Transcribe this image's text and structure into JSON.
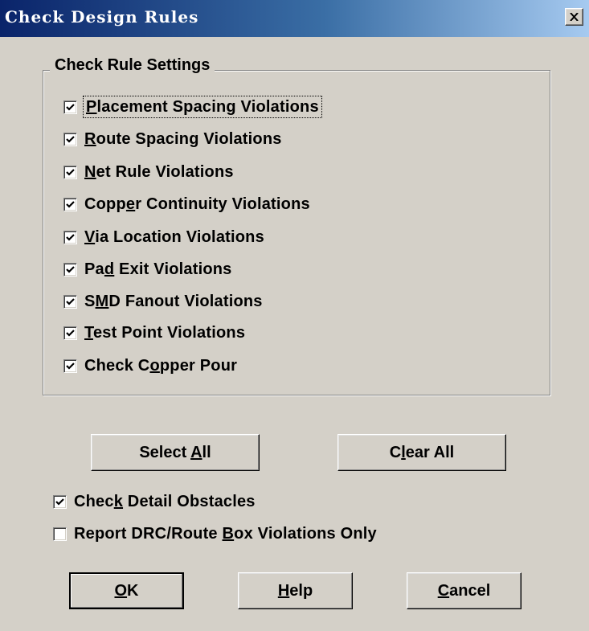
{
  "window": {
    "title": "Check Design Rules"
  },
  "group": {
    "label": "Check Rule Settings",
    "items": [
      {
        "pre": "",
        "ul": "P",
        "post": "lacement Spacing Violations",
        "checked": true
      },
      {
        "pre": "",
        "ul": "R",
        "post": "oute Spacing Violations",
        "checked": true
      },
      {
        "pre": "",
        "ul": "N",
        "post": "et Rule Violations",
        "checked": true
      },
      {
        "pre": "Copp",
        "ul": "e",
        "post": "r Continuity Violations",
        "checked": true
      },
      {
        "pre": "",
        "ul": "V",
        "post": "ia Location Violations",
        "checked": true
      },
      {
        "pre": "Pa",
        "ul": "d",
        "post": " Exit Violations",
        "checked": true
      },
      {
        "pre": "S",
        "ul": "M",
        "post": "D Fanout Violations",
        "checked": true
      },
      {
        "pre": "",
        "ul": "T",
        "post": "est Point Violations",
        "checked": true
      },
      {
        "pre": "Check C",
        "ul": "o",
        "post": "pper Pour",
        "checked": true
      }
    ]
  },
  "select_all": {
    "pre": "Select ",
    "ul": "A",
    "post": "ll"
  },
  "clear_all": {
    "pre": "C",
    "ul": "l",
    "post": "ear All"
  },
  "options": [
    {
      "pre": "Chec",
      "ul": "k",
      "post": " Detail Obstacles",
      "checked": true
    },
    {
      "pre": "Report DRC/Route ",
      "ul": "B",
      "post": "ox Violations Only",
      "checked": false
    }
  ],
  "buttons": {
    "ok": {
      "pre": "",
      "ul": "O",
      "post": "K"
    },
    "help": {
      "pre": "",
      "ul": "H",
      "post": "elp"
    },
    "cancel": {
      "pre": "",
      "ul": "C",
      "post": "ancel"
    }
  }
}
